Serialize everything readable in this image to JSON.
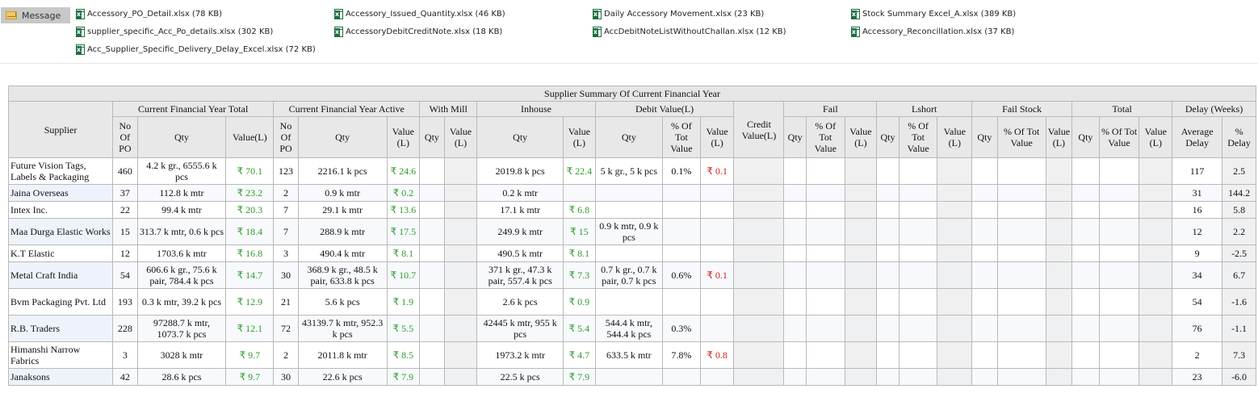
{
  "message_tab": {
    "label": "Message"
  },
  "attachments": [
    {
      "name": "Accessory_PO_Detail.xlsx (78 KB)"
    },
    {
      "name": "supplier_specific_Acc_Po_details.xlsx (302 KB)"
    },
    {
      "name": "Acc_Supplier_Specific_Delivery_Delay_Excel.xlsx (72 KB)"
    },
    {
      "name": "Accessory_Issued_Quantity.xlsx (46 KB)"
    },
    {
      "name": "AccessoryDebitCreditNote.xlsx (18 KB)"
    },
    {
      "name": "Daily Accessory Movement.xlsx (23 KB)"
    },
    {
      "name": "AccDebitNoteListWithoutChallan.xlsx (12 KB)"
    },
    {
      "name": "Stock Summary Excel_A.xlsx (389 KB)"
    },
    {
      "name": "Accessory_Reconcillation.xlsx (37 KB)"
    }
  ],
  "table": {
    "caption": "Supplier Summary Of Current Financial Year",
    "groups": {
      "supplier": "Supplier",
      "total": "Current Financial Year Total",
      "active": "Current Financial Year Active",
      "with_mill": "With Mill",
      "inhouse": "Inhouse",
      "debit": "Debit Value(L)",
      "credit": "Credit Value(L)",
      "fail": "Fail",
      "lshort": "Lshort",
      "fail_stock": "Fail Stock",
      "total2": "Total",
      "delay": "Delay (Weeks)"
    },
    "subheaders": {
      "no_of_po": "No Of PO",
      "qty": "Qty",
      "value_l": "Value(L)",
      "value_l_split": "Value (L)",
      "pct_tot_value": "% Of Tot Value",
      "avg_delay": "Average Delay",
      "pct_delay": "% Delay"
    },
    "rows": [
      {
        "supplier": "Future Vision Tags, Labels & Packaging",
        "t_po": "460",
        "t_qty_num": "4.2",
        "t_qty": "4.2 k gr., 6555.6 k pcs",
        "t_val": "₹ 70.1",
        "a_po": "123",
        "a_qty": "2216.1 k pcs",
        "a_val": "₹ 24.6",
        "ih_qty": "2019.8 k pcs",
        "ih_val": "₹ 22.4",
        "d_qty": "5 k gr., 5 k pcs",
        "d_pct": "0.1%",
        "d_val": "₹ 0.1",
        "avg_delay": "117",
        "pct_delay": "2.5"
      },
      {
        "supplier": "Jaina Overseas",
        "t_po": "37",
        "t_qty": "112.8 k mtr",
        "t_val": "₹ 23.2",
        "a_po": "2",
        "a_qty": "0.9 k mtr",
        "a_val": "₹ 0.2",
        "ih_qty": "0.2 k mtr",
        "ih_val": "",
        "d_qty": "",
        "d_pct": "",
        "d_val": "",
        "avg_delay": "31",
        "pct_delay": "144.2"
      },
      {
        "supplier": "Intex Inc.",
        "t_po": "22",
        "t_qty": "99.4 k mtr",
        "t_val": "₹ 20.3",
        "a_po": "7",
        "a_qty": "29.1 k mtr",
        "a_val": "₹ 13.6",
        "ih_qty": "17.1 k mtr",
        "ih_val": "₹ 6.8",
        "d_qty": "",
        "d_pct": "",
        "d_val": "",
        "avg_delay": "16",
        "pct_delay": "5.8"
      },
      {
        "supplier": "Maa Durga Elastic Works",
        "t_po": "15",
        "t_qty": "313.7 k mtr, 0.6 k pcs",
        "t_val": "₹ 18.4",
        "a_po": "7",
        "a_qty": "288.9 k mtr",
        "a_val": "₹ 17.5",
        "ih_qty": "249.9 k mtr",
        "ih_val": "₹ 15",
        "d_qty": "0.9 k mtr, 0.9 k pcs",
        "d_pct": "",
        "d_val": "",
        "avg_delay": "12",
        "pct_delay": "2.2"
      },
      {
        "supplier": "K.T Elastic",
        "t_po": "12",
        "t_qty": "1703.6 k mtr",
        "t_val": "₹ 16.8",
        "a_po": "3",
        "a_qty": "490.4 k mtr",
        "a_val": "₹ 8.1",
        "ih_qty": "490.5 k mtr",
        "ih_val": "₹ 8.1",
        "d_qty": "",
        "d_pct": "",
        "d_val": "",
        "avg_delay": "9",
        "pct_delay": "-2.5"
      },
      {
        "supplier": "Metal Craft India",
        "t_po": "54",
        "t_qty": "606.6 k gr., 75.6 k pair, 784.4 k pcs",
        "t_val": "₹ 14.7",
        "a_po": "30",
        "a_qty": "368.9 k gr., 48.5 k pair, 633.8 k pcs",
        "a_val": "₹ 10.7",
        "ih_qty": "371 k gr., 47.3 k pair, 557.4 k pcs",
        "ih_val": "₹ 7.3",
        "d_qty": "0.7 k gr., 0.7 k pair, 0.7 k pcs",
        "d_pct": "0.6%",
        "d_val": "₹ 0.1",
        "avg_delay": "34",
        "pct_delay": "6.7"
      },
      {
        "supplier": "Bvm Packaging Pvt. Ltd",
        "t_po": "193",
        "t_qty": "0.3 k mtr, 39.2 k pcs",
        "t_val": "₹ 12.9",
        "a_po": "21",
        "a_qty": "5.6 k pcs",
        "a_val": "₹ 1.9",
        "ih_qty": "2.6 k pcs",
        "ih_val": "₹ 0.9",
        "d_qty": "",
        "d_pct": "",
        "d_val": "",
        "avg_delay": "54",
        "pct_delay": "-1.6"
      },
      {
        "supplier": "R.B. Traders",
        "t_po": "228",
        "t_qty": "97288.7 k mtr, 1073.7 k pcs",
        "t_val": "₹ 12.1",
        "a_po": "72",
        "a_qty": "43139.7 k mtr, 952.3 k pcs",
        "a_val": "₹ 5.5",
        "ih_qty": "42445 k mtr, 955 k pcs",
        "ih_val": "₹ 5.4",
        "d_qty": "544.4 k mtr, 544.4 k pcs",
        "d_pct": "0.3%",
        "d_val": "",
        "avg_delay": "76",
        "pct_delay": "-1.1"
      },
      {
        "supplier": "Himanshi Narrow Fabrics",
        "t_po": "3",
        "t_qty": "3028 k mtr",
        "t_val": "₹ 9.7",
        "a_po": "2",
        "a_qty": "2011.8 k mtr",
        "a_val": "₹ 8.5",
        "ih_qty": "1973.2 k mtr",
        "ih_val": "₹ 4.7",
        "d_qty": "633.5 k mtr",
        "d_pct": "7.8%",
        "d_val": "₹ 0.8",
        "avg_delay": "2",
        "pct_delay": "7.3"
      },
      {
        "supplier": "Janaksons",
        "t_po": "42",
        "t_qty": "28.6 k pcs",
        "t_val": "₹ 9.7",
        "a_po": "30",
        "a_qty": "22.6 k pcs",
        "a_val": "₹ 7.9",
        "ih_qty": "22.5 k pcs",
        "ih_val": "₹ 7.9",
        "d_qty": "",
        "d_pct": "",
        "d_val": "",
        "avg_delay": "23",
        "pct_delay": "-6.0"
      }
    ]
  },
  "colors": {
    "value_green": "#2a9d2a",
    "value_red": "#d12020",
    "header_grey": "#e8e8e8"
  }
}
